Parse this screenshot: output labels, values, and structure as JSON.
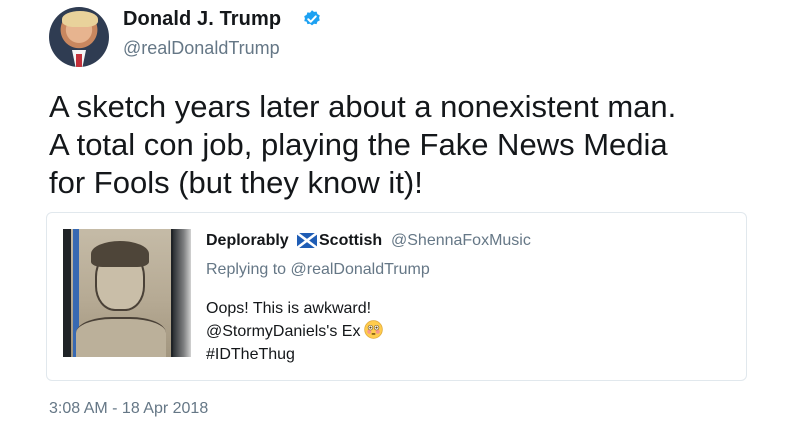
{
  "tweet": {
    "author_name": "Donald J. Trump",
    "handle": "@realDonaldTrump",
    "verified_icon": "verified-badge-icon",
    "text_lines": [
      "A sketch years later about a nonexistent man.",
      "A total con job, playing the Fake News Media",
      "for Fools (but they know it)!"
    ],
    "timestamp": "3:08 AM - 18 Apr 2018"
  },
  "quoted": {
    "name_part1": "Deplorably",
    "name_part2": "Scottish",
    "flag_icon": "scotland-flag-icon",
    "handle": "@ShennaFoxMusic",
    "replying_to": "Replying to @realDonaldTrump",
    "text_lines": [
      "Oops! This is awkward!",
      "@StormyDaniels's Ex",
      "#IDTheThug"
    ],
    "emoji_icon": "flushed-face-icon"
  },
  "colors": {
    "text": "#14171a",
    "secondary": "#657786",
    "verified": "#1da1f2",
    "border": "#e1e8ed"
  }
}
